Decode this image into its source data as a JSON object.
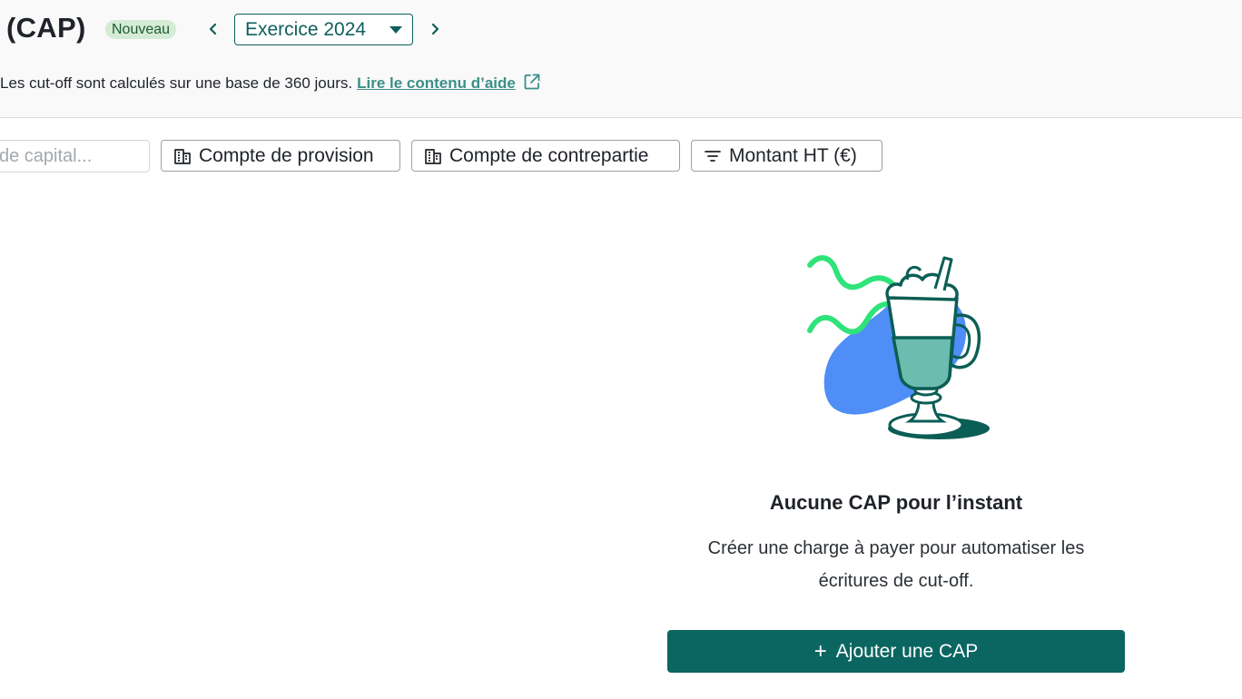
{
  "header": {
    "title": "(CAP)",
    "badge": "Nouveau",
    "prev_icon": "chevron-left-icon",
    "next_icon": "chevron-right-icon",
    "fiscal_year": {
      "selected": "Exercice 2024"
    },
    "info_text": "Les cut-off sont calculés sur une base de 360 jours.",
    "help_link": "Lire le contenu d’aide"
  },
  "filters": {
    "search_placeholder": "de capital...",
    "provision_account": "Compte de provision",
    "counterpart_account": "Compte de contrepartie",
    "amount": "Montant HT (€)"
  },
  "empty_state": {
    "title": "Aucune CAP pour l’instant",
    "description": "Créer une charge à payer pour automatiser les écritures de cut-off.",
    "button": "Ajouter une CAP"
  },
  "colors": {
    "primary": "#0b6662",
    "link": "#3b8f87",
    "badge_bg": "#d4ecd6",
    "illustration_blue": "#4f8ef7",
    "illustration_green": "#2fe37a",
    "illustration_drink": "#6cbdaf"
  }
}
